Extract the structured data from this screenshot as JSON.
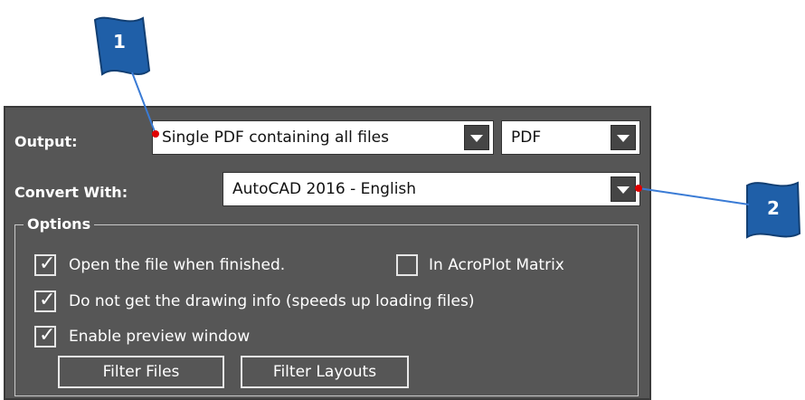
{
  "output": {
    "label": "Output:",
    "format_value": "Single PDF containing all files",
    "type_value": "PDF"
  },
  "convert": {
    "label": "Convert With:",
    "value": "AutoCAD 2016 - English"
  },
  "options": {
    "title": "Options",
    "open_when_finished": {
      "label": "Open the file when finished.",
      "checked": true
    },
    "in_acroplot_matrix": {
      "label": "In AcroPlot Matrix",
      "checked": false
    },
    "no_drawing_info": {
      "label": "Do not get the drawing info (speeds up loading files)",
      "checked": true
    },
    "enable_preview": {
      "label": "Enable preview window",
      "checked": true
    },
    "filter_files_label": "Filter Files",
    "filter_layouts_label": "Filter Layouts"
  },
  "callouts": [
    {
      "number": "1"
    },
    {
      "number": "2"
    }
  ],
  "colors": {
    "panel": "#565656",
    "callout_blue": "#1f5fa8",
    "leader_line": "#3a7bd5",
    "marker_red": "#e00000"
  },
  "icons": {
    "check": "check-icon",
    "dropdown": "chevron-down-icon"
  }
}
